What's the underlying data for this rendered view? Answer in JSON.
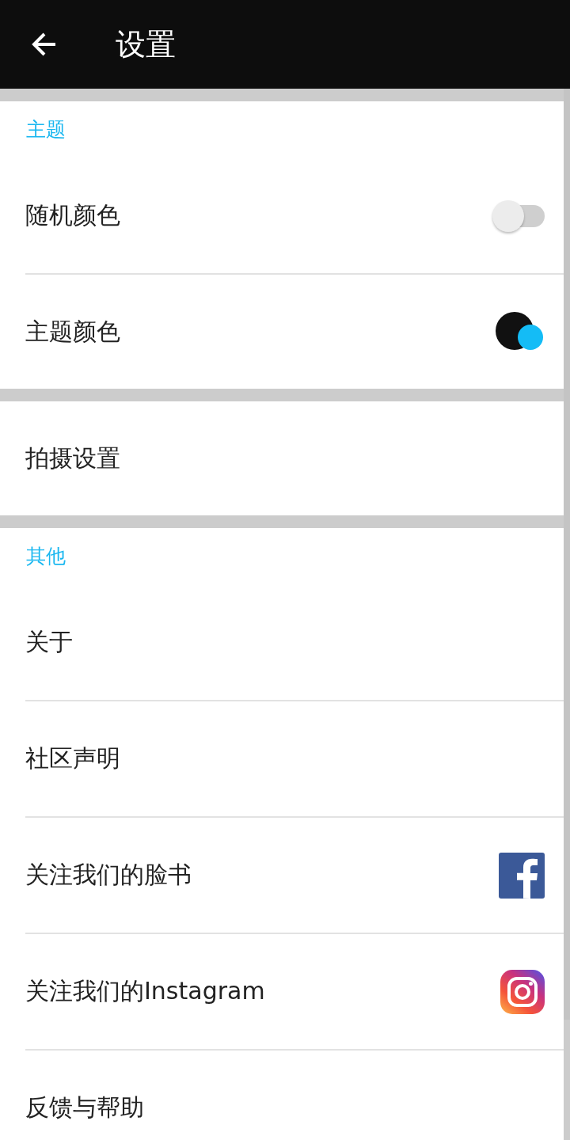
{
  "app_bar": {
    "title": "设置"
  },
  "sections": [
    {
      "header": "主题",
      "items": [
        {
          "kind": "switch",
          "label": "随机颜色",
          "on": false
        },
        {
          "kind": "color",
          "label": "主题颜色",
          "color": "#111111"
        }
      ]
    },
    {
      "items": [
        {
          "kind": "plain",
          "label": "拍摄设置"
        }
      ]
    },
    {
      "header": "其他",
      "items": [
        {
          "kind": "plain",
          "label": "关于"
        },
        {
          "kind": "plain",
          "label": "社区声明"
        },
        {
          "kind": "facebook",
          "label": "关注我们的脸书"
        },
        {
          "kind": "instagram",
          "label": "关注我们的Instagram"
        },
        {
          "kind": "plain",
          "label": "反馈与帮助"
        }
      ]
    }
  ]
}
